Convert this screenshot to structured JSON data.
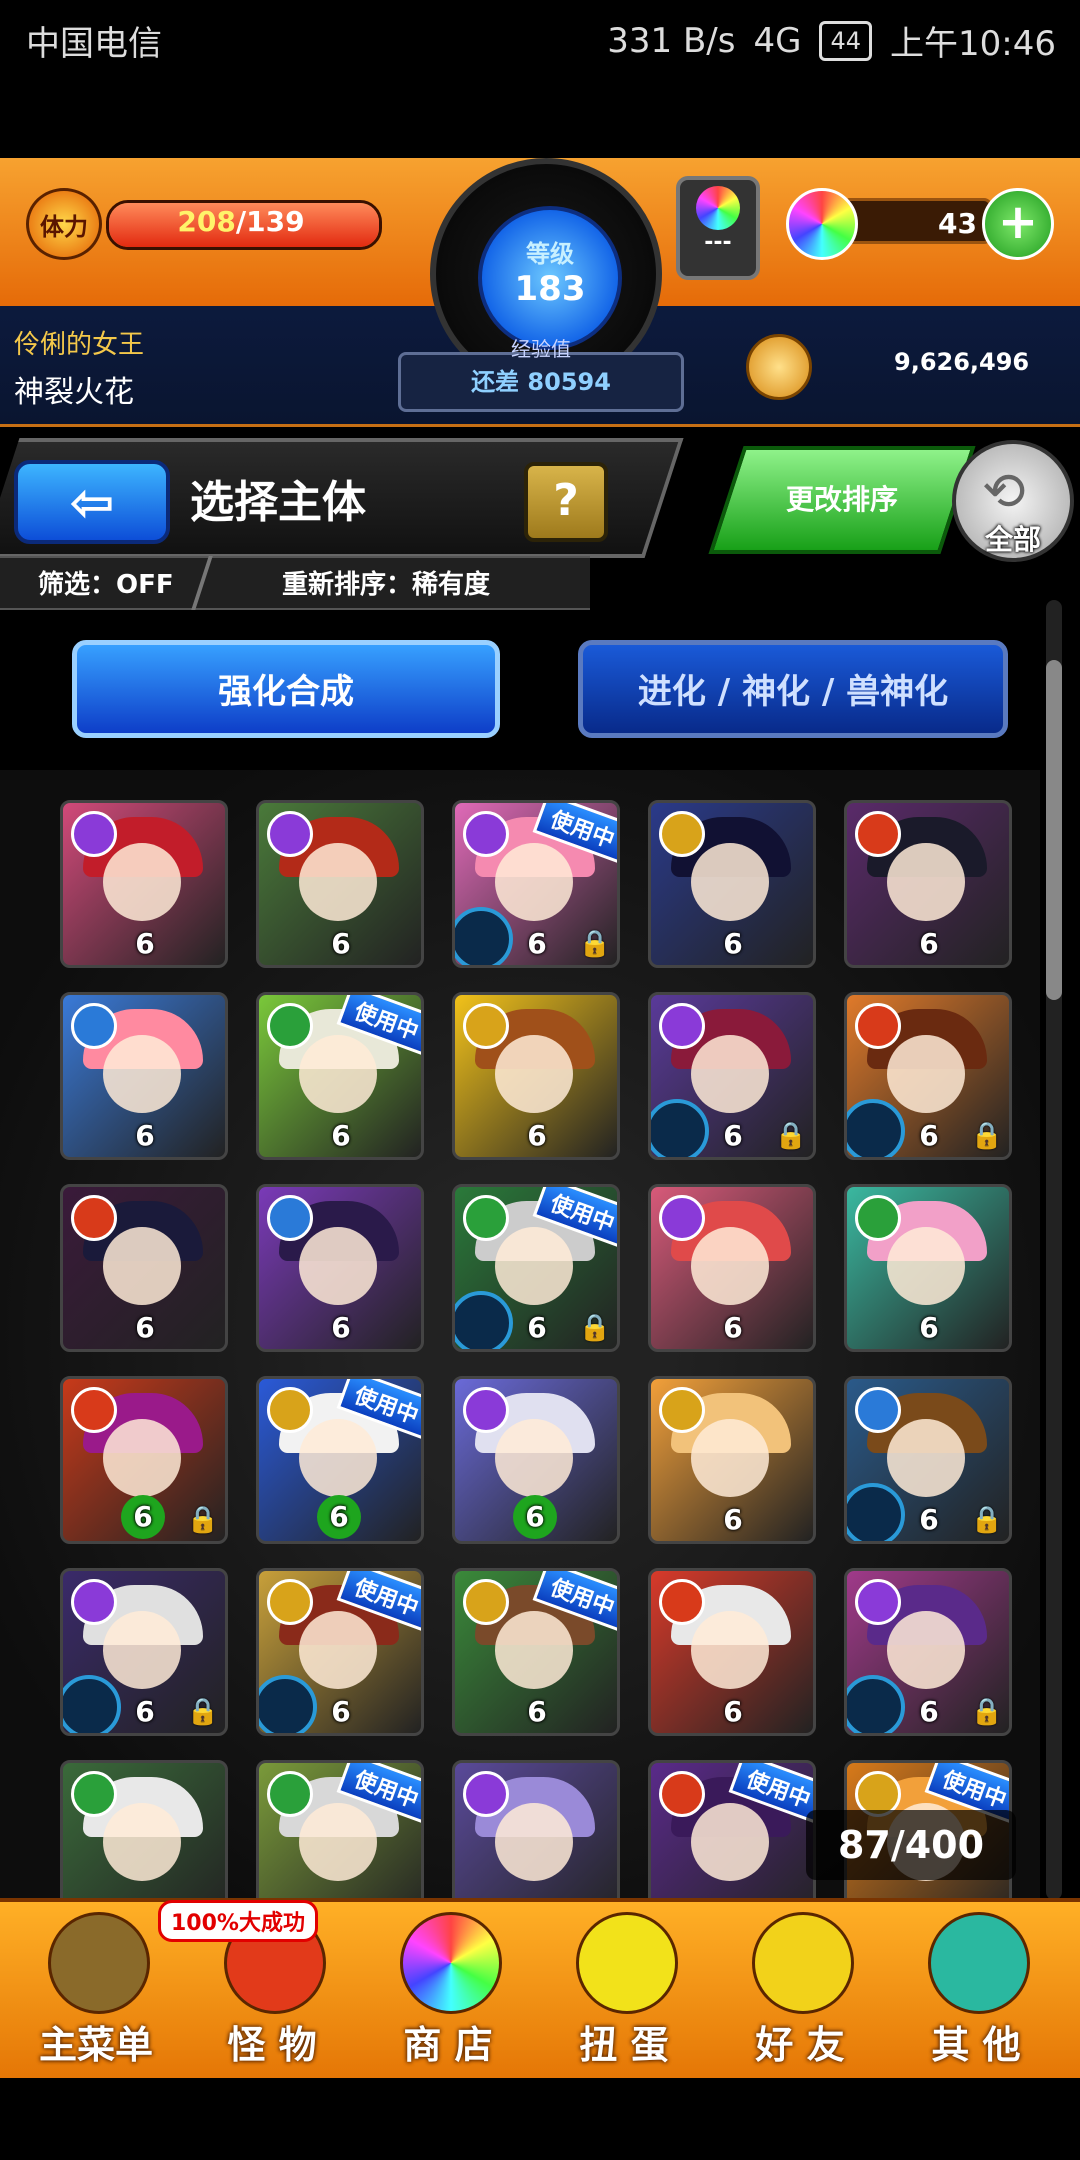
{
  "status": {
    "carrier": "中国电信",
    "speed": "331 B/s",
    "network": "4G",
    "battery": "44",
    "time": "上午10:46"
  },
  "header": {
    "stamina_label": "体力",
    "stamina_current": "208",
    "stamina_max": "/139",
    "level_label": "等级",
    "level": "183",
    "exp_label": "经验值",
    "exp_remaining": "还差 80594",
    "rank_value": "---",
    "orb_count": "43",
    "plus": "+",
    "user_title": "伶俐的女王",
    "user_name": "神裂火花",
    "gold": "9,626,496"
  },
  "titlebar": {
    "back": "⇦",
    "title": "选择主体",
    "help": "?",
    "sort_button": "更改排序",
    "all_label": "全部",
    "all_icon": "⟲"
  },
  "filters": {
    "filter": "筛选：OFF",
    "resort": "重新排序：稀有度"
  },
  "tabs": [
    "强化合成",
    "进化 / 神化 / 兽神化"
  ],
  "inuse_label": "使用中",
  "lock_icon": "🔒",
  "counter": "87/400",
  "nav": [
    {
      "label": "主菜单",
      "icon": "gate-icon"
    },
    {
      "label": "怪 物",
      "icon": "monster-icon"
    },
    {
      "label": "商 店",
      "icon": "rainbow-orb-icon"
    },
    {
      "label": "扭 蛋",
      "icon": "egg-icon"
    },
    {
      "label": "好 友",
      "icon": "balloon-icon"
    },
    {
      "label": "其 他",
      "icon": "question-icon"
    }
  ],
  "badge": "100%大成功",
  "colors": {
    "orange": "#f29118",
    "blue": "#1466e8",
    "green": "#18a018"
  },
  "cards": [
    {
      "attr": "#8a3ad8",
      "bg": "#d24a7a",
      "hair": "#c21d2a",
      "lvl": "6",
      "lock": false,
      "inuse": false,
      "ring": false,
      "clover": false
    },
    {
      "attr": "#8a3ad8",
      "bg": "#4a7a3a",
      "hair": "#b32a18",
      "lvl": "6",
      "lock": false,
      "inuse": false,
      "ring": false,
      "clover": false
    },
    {
      "attr": "#8a3ad8",
      "bg": "#e06ab8",
      "hair": "#f58ab0",
      "lvl": "6",
      "lock": true,
      "inuse": true,
      "ring": true,
      "clover": false
    },
    {
      "attr": "#d8a31a",
      "bg": "#2a3a8a",
      "hair": "#111133",
      "lvl": "6",
      "lock": false,
      "inuse": false,
      "ring": false,
      "clover": false
    },
    {
      "attr": "#d83a1a",
      "bg": "#5a2a6a",
      "hair": "#1a1a2a",
      "lvl": "6",
      "lock": false,
      "inuse": false,
      "ring": false,
      "clover": false
    },
    {
      "attr": "#2a7ad8",
      "bg": "#3a7ad8",
      "hair": "#ff8aa0",
      "lvl": "6",
      "lock": false,
      "inuse": false,
      "ring": false,
      "clover": false
    },
    {
      "attr": "#2aa03a",
      "bg": "#7ac83a",
      "hair": "#e8e8d8",
      "lvl": "6",
      "lock": false,
      "inuse": true,
      "ring": false,
      "clover": false
    },
    {
      "attr": "#d8a31a",
      "bg": "#f2c21a",
      "hair": "#a0501a",
      "lvl": "6",
      "lock": false,
      "inuse": false,
      "ring": false,
      "clover": false
    },
    {
      "attr": "#8a3ad8",
      "bg": "#5a3a9a",
      "hair": "#8a1a3a",
      "lvl": "6",
      "lock": true,
      "inuse": false,
      "ring": true,
      "clover": false
    },
    {
      "attr": "#d83a1a",
      "bg": "#e07a2a",
      "hair": "#6a2a10",
      "lvl": "6",
      "lock": true,
      "inuse": false,
      "ring": true,
      "clover": false
    },
    {
      "attr": "#d83a1a",
      "bg": "#3a1a3a",
      "hair": "#1a1a3a",
      "lvl": "6",
      "lock": false,
      "inuse": false,
      "ring": false,
      "clover": false
    },
    {
      "attr": "#2a7ad8",
      "bg": "#7a3ab8",
      "hair": "#2a1a4a",
      "lvl": "6",
      "lock": false,
      "inuse": false,
      "ring": false,
      "clover": false
    },
    {
      "attr": "#2aa03a",
      "bg": "#2a7a3a",
      "hair": "#cccccc",
      "lvl": "6",
      "lock": true,
      "inuse": true,
      "ring": true,
      "clover": false
    },
    {
      "attr": "#8a3ad8",
      "bg": "#d85a7a",
      "hair": "#e04a4a",
      "lvl": "6",
      "lock": false,
      "inuse": false,
      "ring": false,
      "clover": false
    },
    {
      "attr": "#2aa03a",
      "bg": "#3ab8a0",
      "hair": "#f2a0c8",
      "lvl": "6",
      "lock": false,
      "inuse": false,
      "ring": false,
      "clover": false
    },
    {
      "attr": "#d83a1a",
      "bg": "#c83a1a",
      "hair": "#9a1a8a",
      "lvl": "6",
      "lock": true,
      "inuse": false,
      "ring": false,
      "clover": true
    },
    {
      "attr": "#d8a31a",
      "bg": "#2a5ad8",
      "hair": "#f2f2f2",
      "lvl": "6",
      "lock": false,
      "inuse": true,
      "ring": false,
      "clover": true
    },
    {
      "attr": "#8a3ad8",
      "bg": "#6a6ad8",
      "hair": "#e0e0f0",
      "lvl": "6",
      "lock": false,
      "inuse": false,
      "ring": false,
      "clover": true
    },
    {
      "attr": "#d8a31a",
      "bg": "#f2a03a",
      "hair": "#f2c27a",
      "lvl": "6",
      "lock": false,
      "inuse": false,
      "ring": false,
      "clover": false
    },
    {
      "attr": "#2a7ad8",
      "bg": "#2a5a8a",
      "hair": "#7a4a1a",
      "lvl": "6",
      "lock": true,
      "inuse": false,
      "ring": true,
      "clover": false
    },
    {
      "attr": "#8a3ad8",
      "bg": "#3a2a6a",
      "hair": "#e0e0e0",
      "lvl": "6",
      "lock": true,
      "inuse": false,
      "ring": true,
      "clover": false
    },
    {
      "attr": "#d8a31a",
      "bg": "#c8a03a",
      "hair": "#8a2a1a",
      "lvl": "6",
      "lock": false,
      "inuse": true,
      "ring": true,
      "clover": false
    },
    {
      "attr": "#d8a31a",
      "bg": "#3a8a3a",
      "hair": "#7a4a2a",
      "lvl": "6",
      "lock": false,
      "inuse": true,
      "ring": false,
      "clover": false
    },
    {
      "attr": "#d83a1a",
      "bg": "#d83a2a",
      "hair": "#e8e8e8",
      "lvl": "6",
      "lock": false,
      "inuse": false,
      "ring": false,
      "clover": false
    },
    {
      "attr": "#8a3ad8",
      "bg": "#a03a8a",
      "hair": "#5a2a8a",
      "lvl": "6",
      "lock": true,
      "inuse": false,
      "ring": true,
      "clover": false
    },
    {
      "attr": "#2aa03a",
      "bg": "#3a6a3a",
      "hair": "#e8e8e8",
      "lvl": "",
      "lock": false,
      "inuse": false,
      "ring": false,
      "clover": false
    },
    {
      "attr": "#2aa03a",
      "bg": "#7a9a3a",
      "hair": "#d8d8d8",
      "lvl": "",
      "lock": false,
      "inuse": true,
      "ring": false,
      "clover": false
    },
    {
      "attr": "#8a3ad8",
      "bg": "#5a4a9a",
      "hair": "#9a8ad8",
      "lvl": "",
      "lock": false,
      "inuse": false,
      "ring": false,
      "clover": false
    },
    {
      "attr": "#d83a1a",
      "bg": "#5a2a8a",
      "hair": "#3a1a5a",
      "lvl": "",
      "lock": false,
      "inuse": true,
      "ring": false,
      "clover": false
    },
    {
      "attr": "#d8a31a",
      "bg": "#d87a1a",
      "hair": "#f2a03a",
      "lvl": "",
      "lock": false,
      "inuse": true,
      "ring": false,
      "clover": false
    }
  ]
}
